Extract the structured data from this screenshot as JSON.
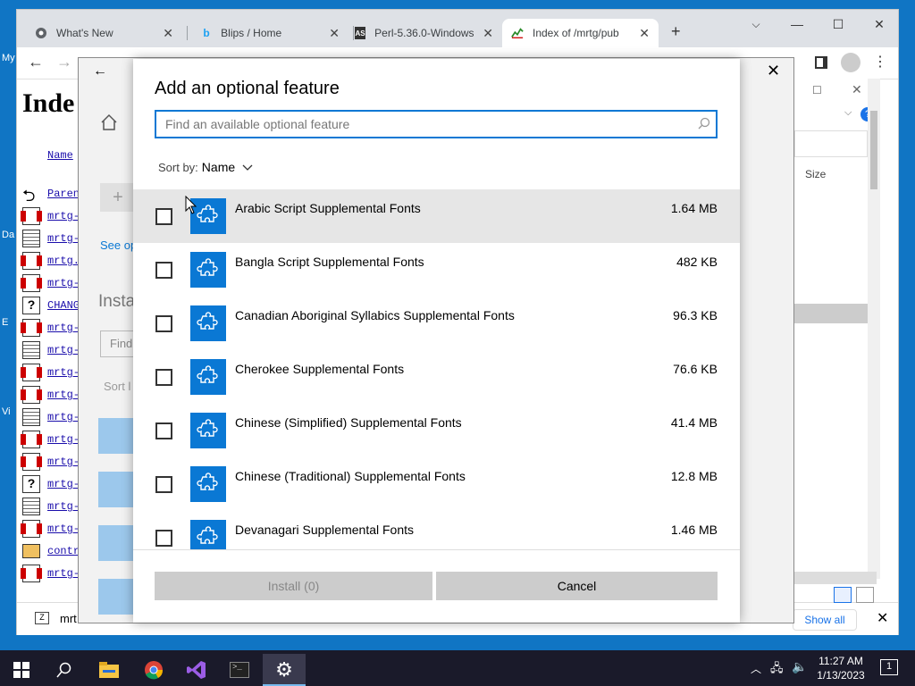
{
  "desktop": {
    "labels": [
      "My",
      "Da",
      "E",
      "Vi"
    ]
  },
  "browser": {
    "tabs": [
      {
        "title": "What's New",
        "icon": "chrome-icon"
      },
      {
        "title": "Blips / Home",
        "icon": "blips-b-icon"
      },
      {
        "title": "Perl-5.36.0-Windows",
        "icon": "as-icon"
      },
      {
        "title": "Index of /mrtg/pub",
        "icon": "mrtg-graph-icon"
      }
    ],
    "page": {
      "heading": "Inde",
      "name_header": "Name",
      "rows": [
        "Paren",
        "mrtg-",
        "mrtg-",
        "mrtg.",
        "mrtg-",
        "CHANG",
        "mrtg-",
        "mrtg-",
        "mrtg-",
        "mrtg-",
        "mrtg-",
        "mrtg-",
        "mrtg-",
        "mrtg-",
        "mrtg-",
        "mrtg-",
        "contr",
        "mrtg-"
      ]
    },
    "downloads_bar": {
      "item": "mrt",
      "show_all": "Show all"
    }
  },
  "explorer_bg": {
    "size_header": "Size"
  },
  "settings_bg": {
    "see_link": "See op",
    "installed_heading": "Insta",
    "find_placeholder": "Find",
    "sort_text": "Sort l"
  },
  "dialog": {
    "title": "Add an optional feature",
    "search_placeholder": "Find an available optional feature",
    "sort_label": "Sort by:",
    "sort_value": "Name",
    "features": [
      {
        "name": "Arabic Script Supplemental Fonts",
        "size": "1.64 MB"
      },
      {
        "name": "Bangla Script Supplemental Fonts",
        "size": "482 KB"
      },
      {
        "name": "Canadian Aboriginal Syllabics Supplemental Fonts",
        "size": "96.3 KB"
      },
      {
        "name": "Cherokee Supplemental Fonts",
        "size": "76.6 KB"
      },
      {
        "name": "Chinese (Simplified) Supplemental Fonts",
        "size": "41.4 MB"
      },
      {
        "name": "Chinese (Traditional) Supplemental Fonts",
        "size": "12.8 MB"
      },
      {
        "name": "Devanagari Supplemental Fonts",
        "size": "1.46 MB"
      }
    ],
    "install_label": "Install (0)",
    "cancel_label": "Cancel"
  },
  "taskbar": {
    "time": "11:27 AM",
    "date": "1/13/2023",
    "notification_count": "1"
  },
  "colors": {
    "accent": "#0a78d4",
    "desktop": "#1075c4",
    "taskbar": "#1a1a2a"
  }
}
